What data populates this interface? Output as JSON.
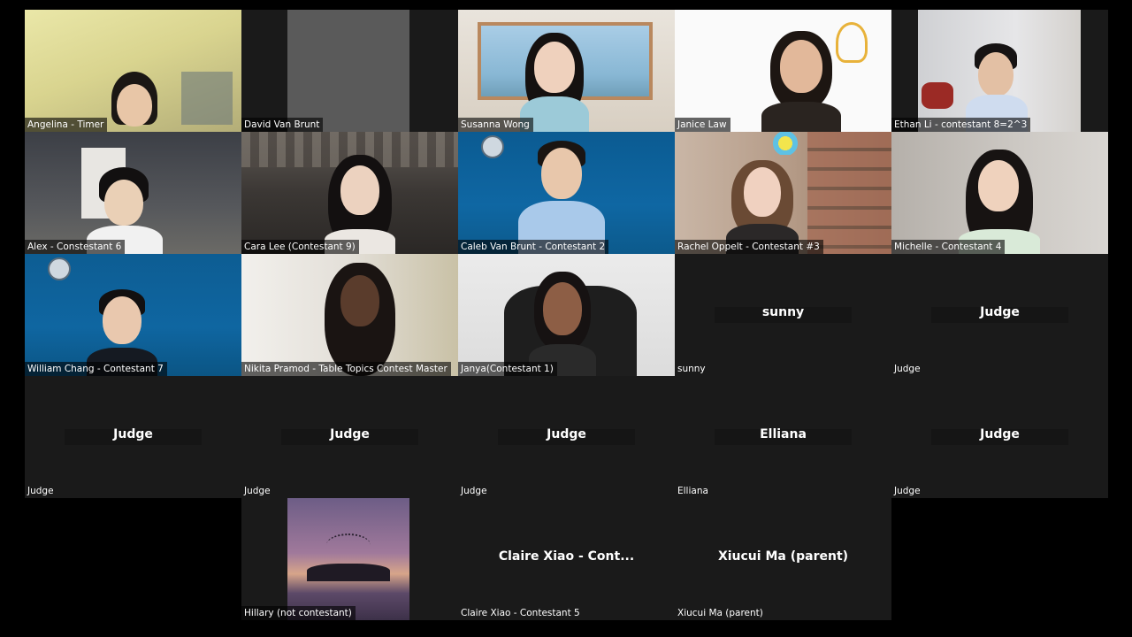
{
  "participants": [
    {
      "name": "Angelina - Timer"
    },
    {
      "name": "David Van Brunt"
    },
    {
      "name": "Susanna Wong"
    },
    {
      "name": "Janice Law"
    },
    {
      "name": "Ethan Li - contestant 8=2^3"
    },
    {
      "name": "Alex - Constestant 6"
    },
    {
      "name": "Cara Lee (Contestant 9)"
    },
    {
      "name": "Caleb Van Brunt - Contestant 2"
    },
    {
      "name": "Rachel Oppelt - Contestant #3"
    },
    {
      "name": "Michelle - Contestant 4"
    },
    {
      "name": "William Chang - Contestant 7"
    },
    {
      "name": "Nikita Pramod - Table Topics Contest Master"
    },
    {
      "name": "Janya(Contestant 1)"
    },
    {
      "name": "sunny",
      "display": "sunny"
    },
    {
      "name": "Judge",
      "display": "Judge"
    },
    {
      "name": "Judge",
      "display": "Judge"
    },
    {
      "name": "Judge",
      "display": "Judge"
    },
    {
      "name": "Judge",
      "display": "Judge"
    },
    {
      "name": "Elliana",
      "display": "Elliana"
    },
    {
      "name": "Judge",
      "display": "Judge"
    },
    {
      "name": "Hillary (not contestant)"
    },
    {
      "name": "Claire Xiao - Contestant 5",
      "display": "Claire Xiao - Cont..."
    },
    {
      "name": "Xiucui Ma (parent)",
      "display": "Xiucui Ma (parent)"
    }
  ]
}
